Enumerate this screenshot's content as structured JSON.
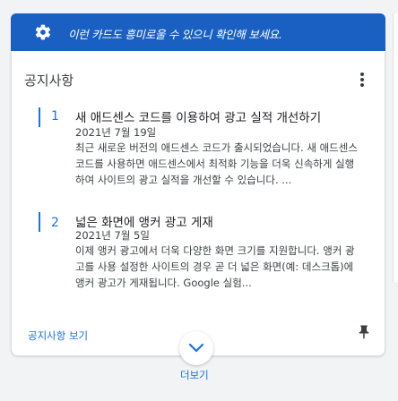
{
  "banner": {
    "text": "이런 카드도 흥미로울 수 있으니 확인해 보세요.",
    "icon": "settings-gear-icon"
  },
  "card": {
    "title": "공지사항",
    "items": [
      {
        "number": "1",
        "title": "새 애드센스 코드를 이용하여 광고 실적 개선하기",
        "date": "2021년 7월 19일",
        "body": "최근 새로운 버전의 애드센스 코드가 출시되었습니다. 새 애드센스 코드를 사용하면 애드센스에서 최적화 기능을 더욱 신속하게 실행하여 사이트의 광고 실적을 개선할 수 있습니다. ..."
      },
      {
        "number": "2",
        "title": "넓은 화면에 앵커 광고 게재",
        "date": "2021년 7월 5일",
        "body": "이제 앵커 광고에서 더욱 다양한 화면 크기를 지원합니다. 앵커 광고를 사용 설정한 사이트의 경우 곧 더 넓은 화면(예: 데스크톱)에 앵커 광고가 게재됩니다. Google 실험..."
      }
    ],
    "link": "공지사항 보기"
  },
  "footer": {
    "more": "더보기"
  },
  "colors": {
    "banner": "#1a5fc2",
    "accent": "#1a73e8"
  }
}
